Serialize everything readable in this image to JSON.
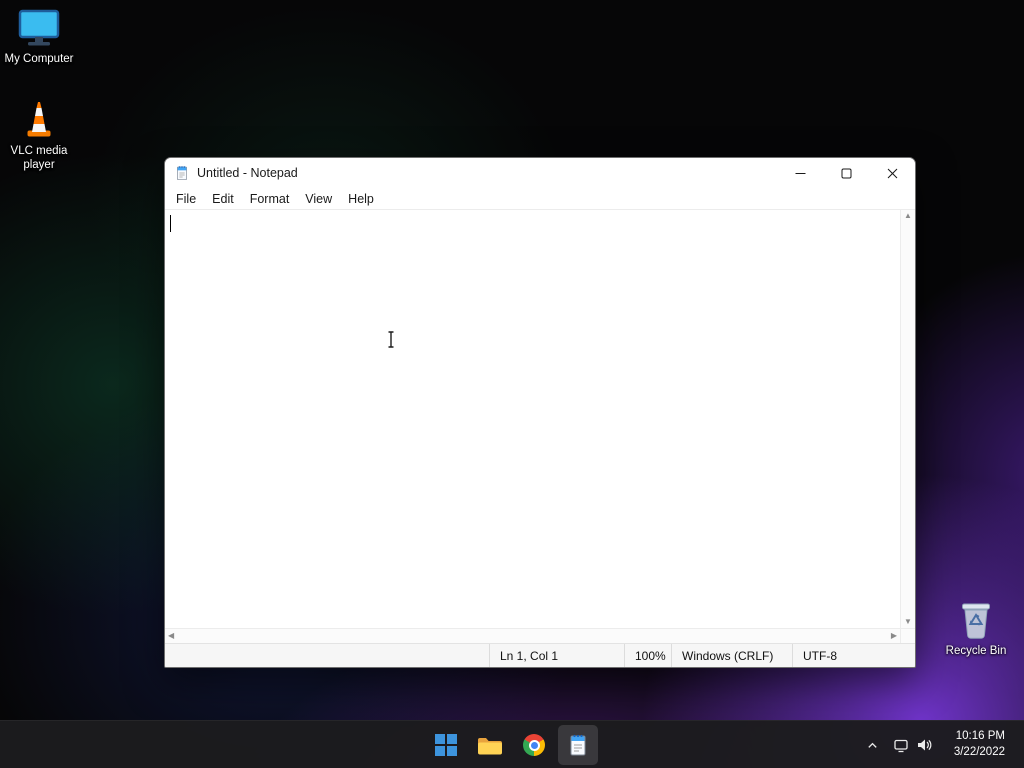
{
  "desktop": {
    "icons": [
      {
        "label": "My Computer",
        "icon": "computer-icon"
      },
      {
        "label": "VLC media player",
        "icon": "vlc-icon"
      },
      {
        "label": "Recycle Bin",
        "icon": "recycle-bin-icon"
      }
    ]
  },
  "notepad": {
    "title": "Untitled - Notepad",
    "menu": [
      "File",
      "Edit",
      "Format",
      "View",
      "Help"
    ],
    "editor_content": "",
    "status_bar": {
      "cursor_position": "Ln 1, Col 1",
      "zoom": "100%",
      "line_ending": "Windows (CRLF)",
      "encoding": "UTF-8"
    }
  },
  "taskbar": {
    "apps": [
      {
        "name": "start",
        "icon": "windows-start-icon"
      },
      {
        "name": "file-explorer",
        "icon": "folder-icon"
      },
      {
        "name": "chrome",
        "icon": "chrome-icon"
      },
      {
        "name": "notepad",
        "icon": "notepad-icon",
        "active": true
      }
    ],
    "tray": {
      "time": "10:16 PM",
      "date": "3/22/2022"
    }
  },
  "colors": {
    "accent_blue": "#42a5f5",
    "taskbar_bg": "#1c1c1e",
    "status_bar_bg": "#f6f6f6"
  }
}
